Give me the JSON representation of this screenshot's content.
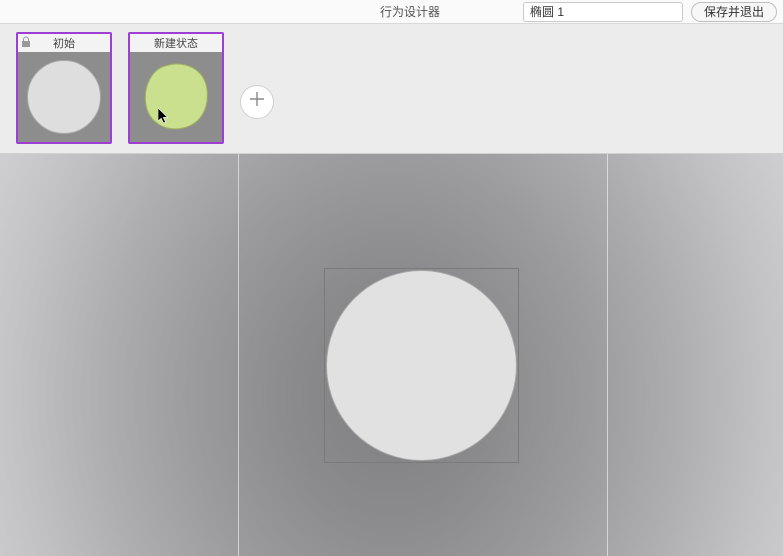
{
  "header": {
    "title": "行为设计器",
    "object_name": "椭圆 1",
    "save_exit_label": "保存并退出"
  },
  "states": {
    "items": [
      {
        "label": "初始",
        "locked": true,
        "shape": "circle",
        "fill": "#dedede"
      },
      {
        "label": "新建状态",
        "locked": false,
        "shape": "blob",
        "fill": "#cbe08e"
      }
    ],
    "add_tooltip": "添加状态"
  },
  "canvas": {
    "selected_object": "椭圆 1"
  }
}
